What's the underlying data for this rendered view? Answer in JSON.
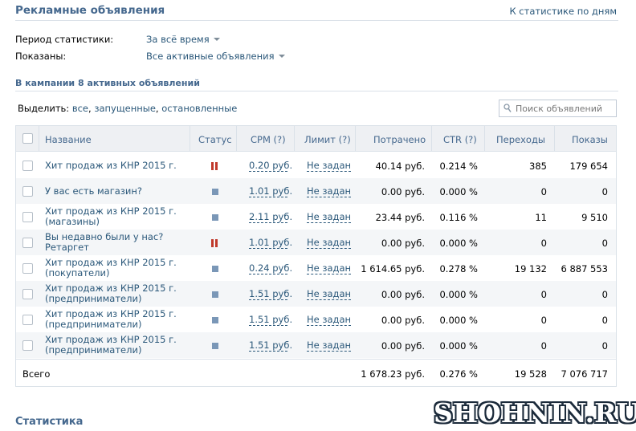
{
  "header": {
    "title": "Рекламные объявления",
    "daily_link": "К статистике по дням"
  },
  "filters": {
    "period_label": "Период статистики:",
    "period_value": "За всё время",
    "shown_label": "Показаны:",
    "shown_value": "Все активные объявления"
  },
  "campaign_heading": "В кампании 8 активных объявлений",
  "select": {
    "prefix": "Выделить:",
    "all": "все",
    "running": "запущенные",
    "stopped": "остановленные"
  },
  "search": {
    "placeholder": "Поиск объявлений",
    "value": ""
  },
  "columns": {
    "name": "Название",
    "status": "Статус",
    "cpm": "CPM (?)",
    "limit": "Лимит (?)",
    "spent": "Потрачено",
    "ctr": "CTR (?)",
    "clicks": "Переходы",
    "shows": "Показы"
  },
  "rows": [
    {
      "line1": "Хит продаж из КНР 2015 г.",
      "line2": "",
      "status": "paused",
      "cpm": "0.20 руб.",
      "limit": "Не задан",
      "spent": "40.14 руб.",
      "ctr": "0.214 %",
      "clicks": "385",
      "shows": "179 654"
    },
    {
      "line1": "У вас есть магазин?",
      "line2": "",
      "status": "running",
      "cpm": "1.01 руб.",
      "limit": "Не задан",
      "spent": "0.00 руб.",
      "ctr": "0.000 %",
      "clicks": "0",
      "shows": "0"
    },
    {
      "line1": "Хит продаж из КНР 2015 г.",
      "line2": "(магазины)",
      "status": "running",
      "cpm": "2.11 руб.",
      "limit": "Не задан",
      "spent": "23.44 руб.",
      "ctr": "0.116 %",
      "clicks": "11",
      "shows": "9 510"
    },
    {
      "line1": "Вы недавно были у нас?",
      "line2": "Ретаргет",
      "status": "paused",
      "cpm": "1.01 руб.",
      "limit": "Не задан",
      "spent": "0.00 руб.",
      "ctr": "0.000 %",
      "clicks": "0",
      "shows": "0"
    },
    {
      "line1": "Хит продаж из КНР 2015 г.",
      "line2": "(покупатели)",
      "status": "running",
      "cpm": "0.24 руб.",
      "limit": "Не задан",
      "spent": "1 614.65 руб.",
      "ctr": "0.278 %",
      "clicks": "19 132",
      "shows": "6 887 553"
    },
    {
      "line1": "Хит продаж из КНР 2015 г.",
      "line2": "(предприниматели)",
      "status": "running",
      "cpm": "1.51 руб.",
      "limit": "Не задан",
      "spent": "0.00 руб.",
      "ctr": "0.000 %",
      "clicks": "0",
      "shows": "0"
    },
    {
      "line1": "Хит продаж из КНР 2015 г.",
      "line2": "(предприниматели)",
      "status": "running",
      "cpm": "1.51 руб.",
      "limit": "Не задан",
      "spent": "0.00 руб.",
      "ctr": "0.000 %",
      "clicks": "0",
      "shows": "0"
    },
    {
      "line1": "Хит продаж из КНР 2015 г.",
      "line2": "(предприниматели)",
      "status": "running",
      "cpm": "1.51 руб.",
      "limit": "Не задан",
      "spent": "0.00 руб.",
      "ctr": "0.000 %",
      "clicks": "0",
      "shows": "0"
    }
  ],
  "total": {
    "label": "Всего",
    "spent": "1 678.23 руб.",
    "ctr": "0.276 %",
    "clicks": "19 528",
    "shows": "7 076 717"
  },
  "statistics_heading": "Статистика",
  "watermark": "SHOHNIN.RU",
  "icons": {
    "search": "magnifier-icon",
    "caret": "caret-down-icon",
    "paused": "pause-icon",
    "running": "running-square-icon"
  },
  "colors": {
    "link": "#2b587a",
    "heading": "#45688e",
    "pause": "#c0392b",
    "running": "#7a97b7"
  }
}
